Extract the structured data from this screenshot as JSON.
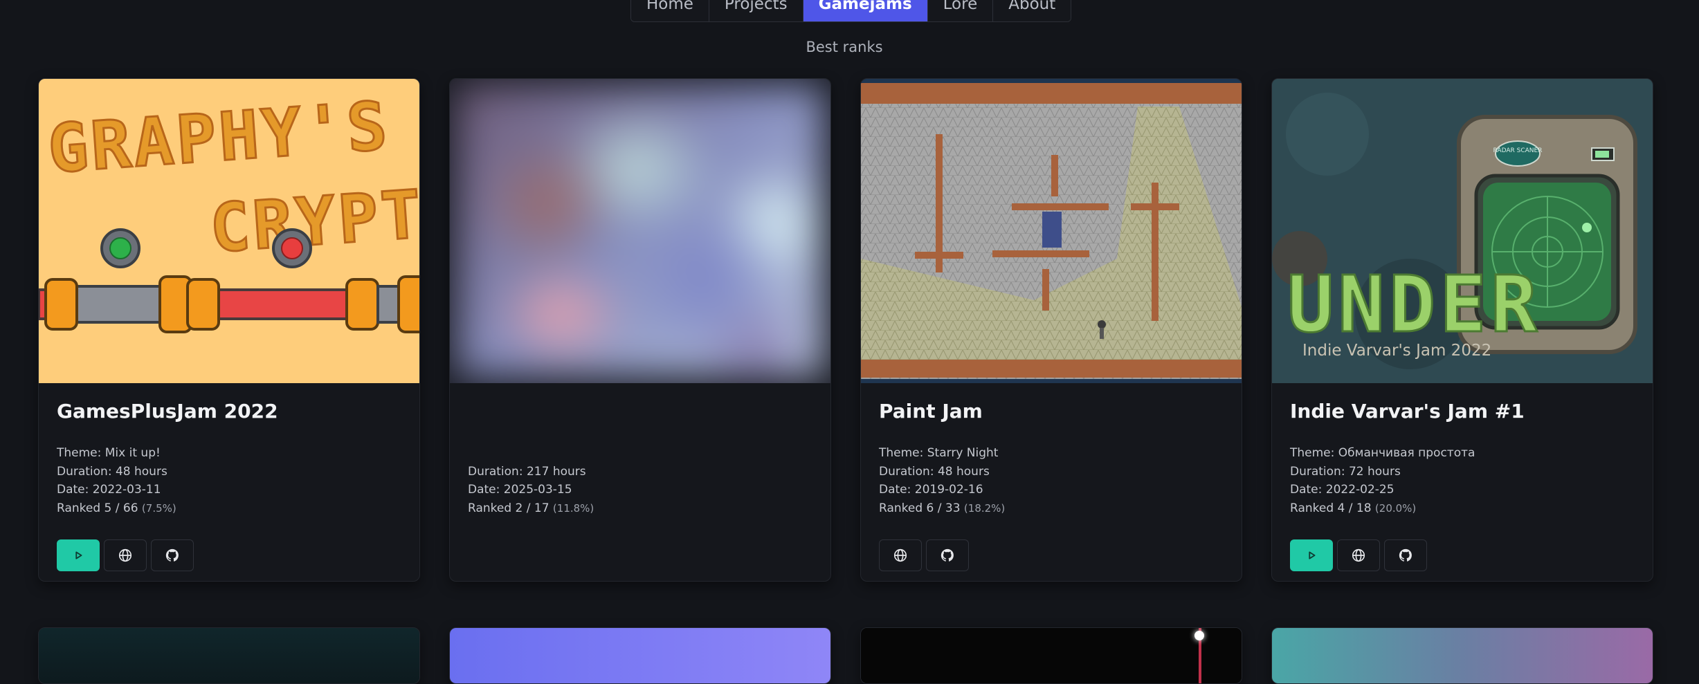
{
  "nav": {
    "items": [
      "Home",
      "Projects",
      "Gamejams",
      "Lore",
      "About"
    ],
    "active_index": 2
  },
  "section_title": "Best ranks",
  "cards": [
    {
      "title": "GamesPlusJam 2022",
      "thumb_title_line1": "GRAPHY'S",
      "thumb_title_line2": "CRYPT",
      "theme": "Theme: Mix it up!",
      "duration": "Duration: 48 hours",
      "date": "Date: 2022-03-11",
      "rank": "Ranked 5 / 66",
      "rank_pct": "(7.5%)",
      "buttons": [
        "play-icon",
        "globe-icon",
        "github-icon"
      ]
    },
    {
      "title": "",
      "theme": "",
      "duration": "Duration: 217 hours",
      "date": "Date: 2025-03-15",
      "rank": "Ranked 2 / 17",
      "rank_pct": "(11.8%)",
      "buttons": []
    },
    {
      "title": "Paint Jam",
      "theme": "Theme: Starry Night",
      "duration": "Duration: 48 hours",
      "date": "Date: 2019-02-16",
      "rank": "Ranked 6 / 33",
      "rank_pct": "(18.2%)",
      "buttons": [
        "globe-icon",
        "github-icon"
      ]
    },
    {
      "title": "Indie Varvar's Jam #1",
      "thumb_title": "UNDER",
      "thumb_subtitle": "Indie Varvar's Jam 2022",
      "thumb_device_label": "RADAR SCANER",
      "theme": "Theme: Обманчивая простота",
      "duration": "Duration: 72 hours",
      "date": "Date: 2022-02-25",
      "rank": "Ranked 4 / 18",
      "rank_pct": "(20.0%)",
      "buttons": [
        "play-icon",
        "globe-icon",
        "github-icon"
      ]
    }
  ],
  "colors": {
    "background": "#13151a",
    "card": "#15171c",
    "accent_nav": "#4f56e8",
    "accent_play": "#20c9a6"
  }
}
